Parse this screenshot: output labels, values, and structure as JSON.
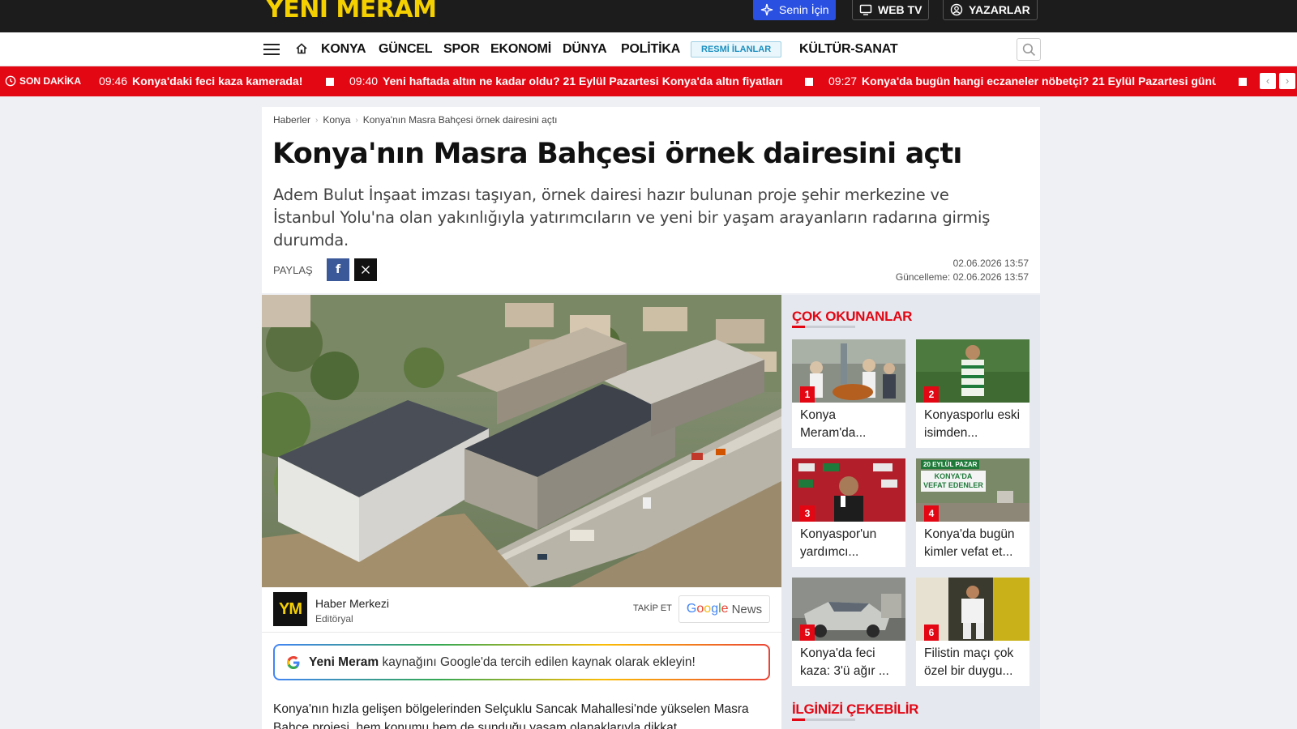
{
  "topbar": {
    "logo": "YENİ MERAM",
    "buttons": [
      {
        "label": "Senin İçin",
        "icon": "sparkle-icon"
      },
      {
        "label": "WEB TV",
        "icon": "tv-icon"
      },
      {
        "label": "YAZARLAR",
        "icon": "user-icon"
      }
    ]
  },
  "nav": {
    "items": [
      "KONYA",
      "GÜNCEL",
      "SPOR",
      "EKONOMİ",
      "DÜNYA",
      "POLİTİKA"
    ],
    "badge": "RESMİ İLANLAR",
    "last": "KÜLTÜR-SANAT"
  },
  "breaking": {
    "label": "SON DAKİKA",
    "items": [
      {
        "time": "09:46",
        "text": "Konya'daki feci kaza kamerada!"
      },
      {
        "time": "09:40",
        "text": "Yeni haftada altın ne kadar oldu? 21 Eylül Pazartesi Konya'da altın fiyatları"
      },
      {
        "time": "09:27",
        "text": "Konya'da bugün hangi eczaneler nöbetçi? 21 Eylül Pazartesi günü"
      }
    ]
  },
  "article": {
    "breadcrumb": [
      "Haberler",
      "Konya",
      "Konya'nın Masra Bahçesi örnek dairesini açtı"
    ],
    "title": "Konya'nın Masra Bahçesi örnek dairesini açtı",
    "lead": "Adem Bulut İnşaat imzası taşıyan, örnek dairesi hazır bulunan proje şehir merkezine ve İstanbul Yolu'na olan yakınlığıyla yatırımcıların ve yeni bir yaşam arayanların radarına girmiş durumda.",
    "share_label": "PAYLAŞ",
    "published": "02.06.2026 13:57",
    "updated": "Güncelleme: 02.06.2026 13:57",
    "author": {
      "badge": "YM",
      "name": "Haber Merkezi",
      "role": "Editöryal"
    },
    "follow_label": "TAKİP ET",
    "gnews_label": "News",
    "gpref": {
      "brand": "Yeni Meram",
      "text": "kaynağını Google'da tercih edilen kaynak olarak ekleyin!"
    },
    "body": "Konya'nın hızla gelişen bölgelerinden Selçuklu Sancak Mahallesi'nde yükselen Masra Bahçe projesi, hem konumu hem de sunduğu yaşam olanaklarıyla dikkat"
  },
  "sidebar": {
    "most_read_title": "ÇOK OKUNANLAR",
    "items": [
      {
        "num": "1",
        "caption": "Konya Meram'da..."
      },
      {
        "num": "2",
        "caption": "Konyasporlu eski isimden..."
      },
      {
        "num": "3",
        "caption": "Konyaspor'un yardımcı..."
      },
      {
        "num": "4",
        "caption": "Konya'da bugün kimler vefat et...",
        "img_text_1": "20 EYLÜL PAZAR",
        "img_text_2": "KONYA'DA VEFAT EDENLER"
      },
      {
        "num": "5",
        "caption": "Konya'da feci kaza: 3'ü ağır ..."
      },
      {
        "num": "6",
        "caption": "Filistin maçı çok özel bir duygu..."
      }
    ],
    "interest_title": "İLGİNİZİ ÇEKEBİLİR"
  }
}
